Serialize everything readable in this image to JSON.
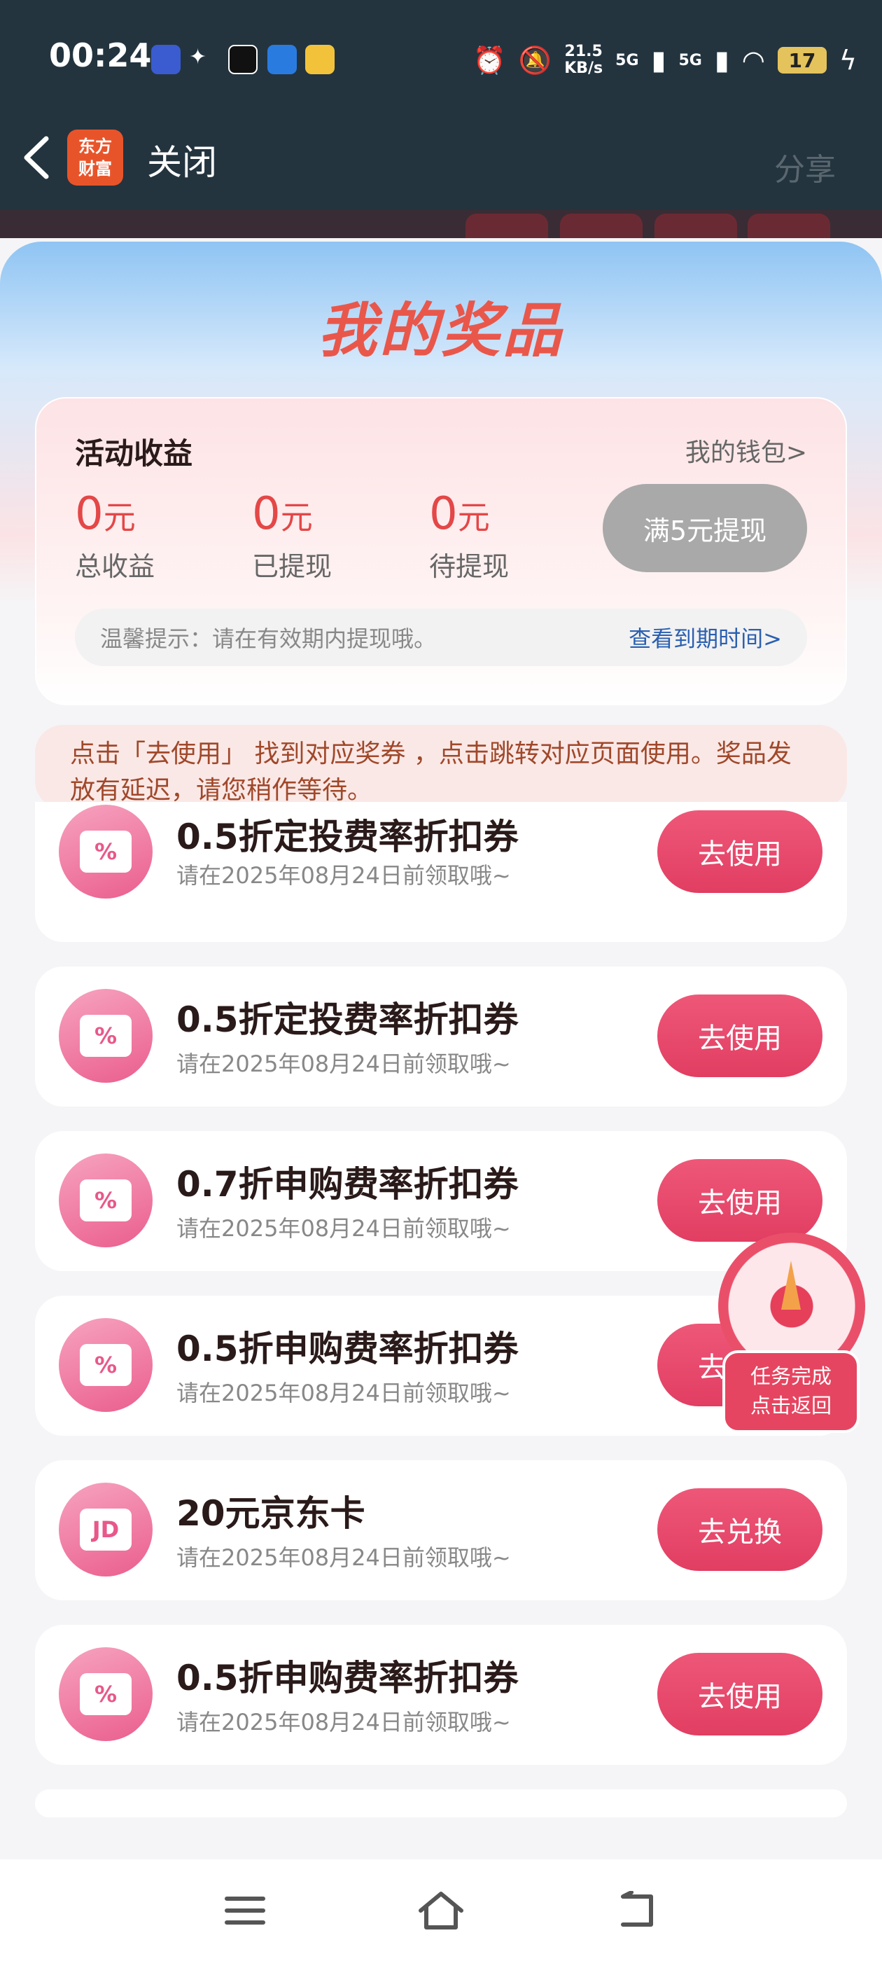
{
  "status_bar": {
    "time": "00:24",
    "speed_value": "21.5",
    "speed_unit": "KB/s",
    "net1": "5G",
    "net2": "5G",
    "battery": "17",
    "app_icons": [
      "vivo-icon",
      "handshake-icon",
      "soul-icon",
      "ai-icon",
      "wallet-icon"
    ]
  },
  "nav": {
    "logo_line1": "东方",
    "logo_line2": "财富",
    "close_label": "关闭",
    "share_label": "分享"
  },
  "sheet": {
    "title": "我的奖品"
  },
  "income": {
    "title": "活动收益",
    "wallet_link": "我的钱包>",
    "stats": [
      {
        "value": "0",
        "unit": "元",
        "label": "总收益"
      },
      {
        "value": "0",
        "unit": "元",
        "label": "已提现"
      },
      {
        "value": "0",
        "unit": "元",
        "label": "待提现"
      }
    ],
    "withdraw_button": "满5元提现",
    "tip_text": "温馨提示：请在有效期内提现哦。",
    "tip_link": "查看到期时间>"
  },
  "notice": "点击「去使用」 找到对应奖券 ，点击跳转对应页面使用。奖品发放有延迟，请您稍作等待。",
  "rewards": [
    {
      "icon": "%",
      "name": "0.5折定投费率折扣券",
      "date": "请在2025年08月24日前领取哦~",
      "button": "去使用"
    },
    {
      "icon": "%",
      "name": "0.5折定投费率折扣券",
      "date": "请在2025年08月24日前领取哦~",
      "button": "去使用"
    },
    {
      "icon": "%",
      "name": "0.7折申购费率折扣券",
      "date": "请在2025年08月24日前领取哦~",
      "button": "去使用"
    },
    {
      "icon": "%",
      "name": "0.5折申购费率折扣券",
      "date": "请在2025年08月24日前领取哦~",
      "button": "去使用"
    },
    {
      "icon": "JD",
      "name": "20元京东卡",
      "date": "请在2025年08月24日前领取哦~",
      "button": "去兑换"
    },
    {
      "icon": "%",
      "name": "0.5折申购费率折扣券",
      "date": "请在2025年08月24日前领取哦~",
      "button": "去使用"
    }
  ],
  "float_widget": {
    "line1": "任务完成",
    "line2": "点击返回"
  },
  "colors": {
    "accent": "#e13e62",
    "title_red": "#e9574b",
    "link_blue": "#2a5fb0",
    "disabled_gray": "#a9a9a9"
  }
}
